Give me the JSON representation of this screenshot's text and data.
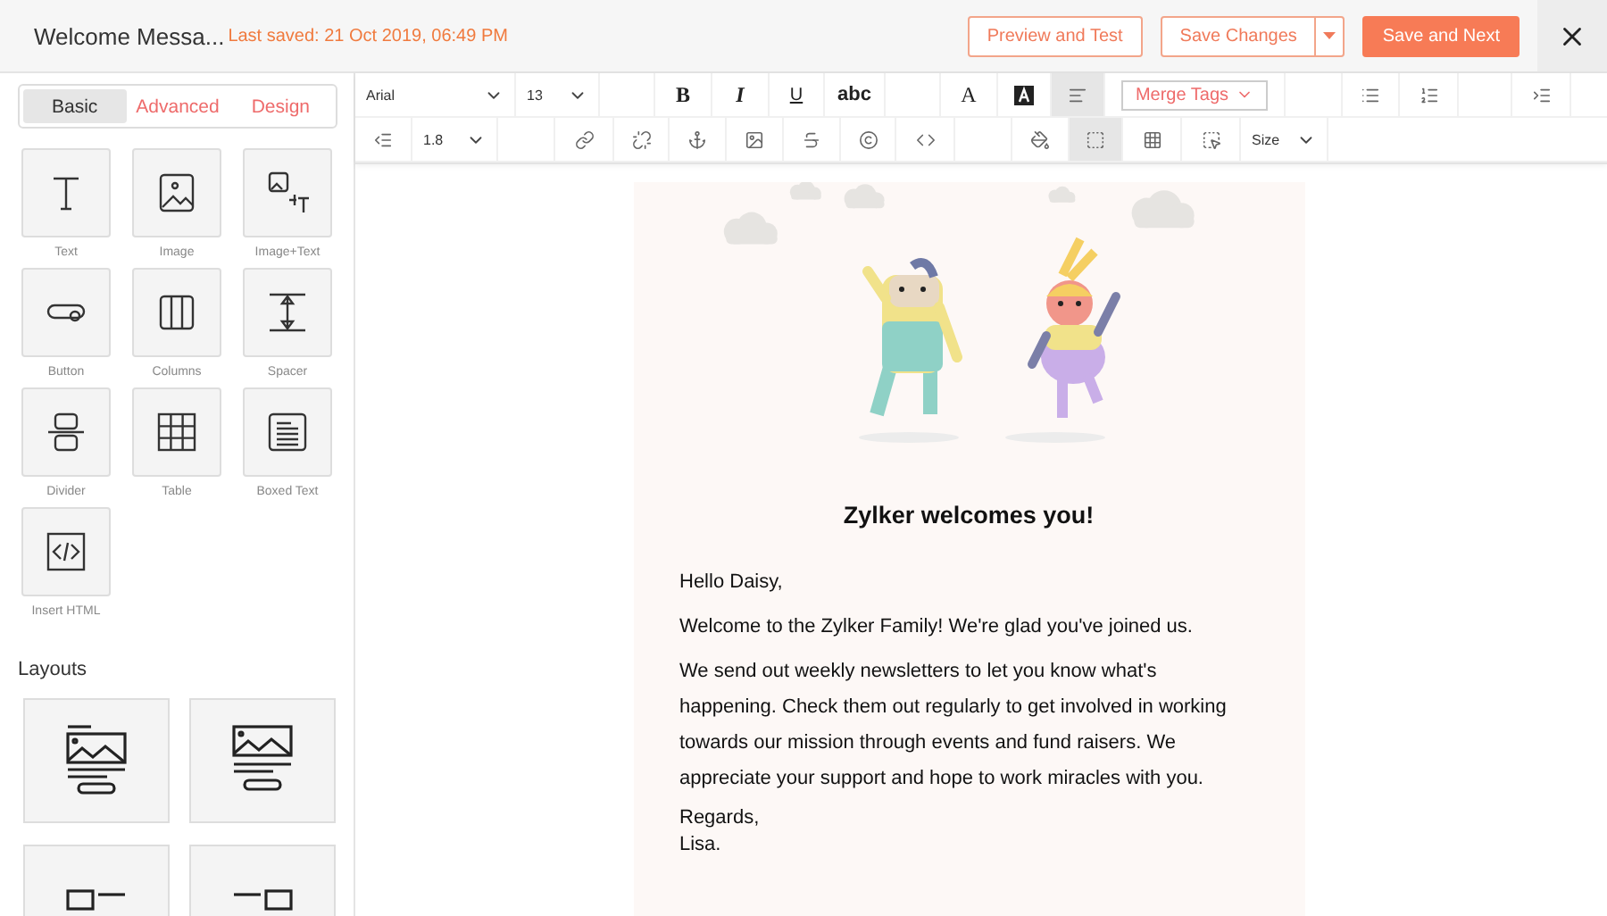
{
  "header": {
    "title": "Welcome Messa...",
    "last_saved": "Last saved: 21 Oct 2019, 06:49 PM",
    "buttons": [
      {
        "label": "Preview and Test",
        "kind": "outline"
      },
      {
        "label": "Save Changes",
        "kind": "split"
      },
      {
        "label": "Save and Next",
        "kind": "primary"
      }
    ]
  },
  "sidebar": {
    "tabs": [
      {
        "label": "Basic",
        "selected": true
      },
      {
        "label": "Advanced",
        "selected": false
      },
      {
        "label": "Design",
        "selected": false
      }
    ],
    "blocks": [
      {
        "label": "Text"
      },
      {
        "label": "Image"
      },
      {
        "label": "Image+Text"
      },
      {
        "label": "Button"
      },
      {
        "label": "Columns"
      },
      {
        "label": "Spacer"
      },
      {
        "label": "Divider"
      },
      {
        "label": "Table"
      },
      {
        "label": "Boxed Text"
      },
      {
        "label": "Insert HTML"
      }
    ],
    "layouts_title": "Layouts"
  },
  "toolbar": {
    "rows": [
      [
        {
          "kind": "select",
          "value": "Arial"
        },
        {
          "kind": "select",
          "value": "13"
        },
        {
          "kind": "blank"
        },
        {
          "kind": "glyph",
          "text": "B"
        },
        {
          "kind": "glyph",
          "text": "I"
        },
        {
          "kind": "glyph",
          "text": "U"
        },
        {
          "kind": "glyph",
          "text": "abc"
        },
        {
          "kind": "blank"
        },
        {
          "kind": "glyph",
          "text": "A"
        },
        {
          "kind": "icon",
          "active": false
        },
        {
          "kind": "icon",
          "active": true
        },
        {
          "kind": "merge",
          "value": "Merge Tags"
        },
        {
          "kind": "blank"
        },
        {
          "kind": "icon",
          "active": false
        },
        {
          "kind": "icon",
          "active": false
        },
        {
          "kind": "blank"
        },
        {
          "kind": "icon",
          "active": false
        }
      ],
      [
        {
          "kind": "icon",
          "active": false
        },
        {
          "kind": "select",
          "value": "1.8"
        },
        {
          "kind": "blank"
        },
        {
          "kind": "icon",
          "active": false
        },
        {
          "kind": "icon",
          "active": false
        },
        {
          "kind": "icon",
          "active": false
        },
        {
          "kind": "icon",
          "active": false
        },
        {
          "kind": "icon",
          "active": false
        },
        {
          "kind": "icon",
          "active": false
        },
        {
          "kind": "icon",
          "active": false
        },
        {
          "kind": "blank"
        },
        {
          "kind": "icon",
          "active": false
        },
        {
          "kind": "icon",
          "active": true
        },
        {
          "kind": "icon",
          "active": false
        },
        {
          "kind": "icon",
          "active": false
        },
        {
          "kind": "select",
          "value": "Size"
        }
      ]
    ]
  },
  "email": {
    "heading": "Zylker welcomes you!",
    "paragraphs": [
      "Hello Daisy,",
      "Welcome to the Zylker Family! We're glad you've joined us.",
      "We send out weekly newsletters to let you know what's happening. Check them out regularly to get involved in working towards our mission through events and fund raisers. We appreciate your support and hope to work miracles with you."
    ],
    "signoff": [
      "Regards,",
      "Lisa."
    ]
  }
}
